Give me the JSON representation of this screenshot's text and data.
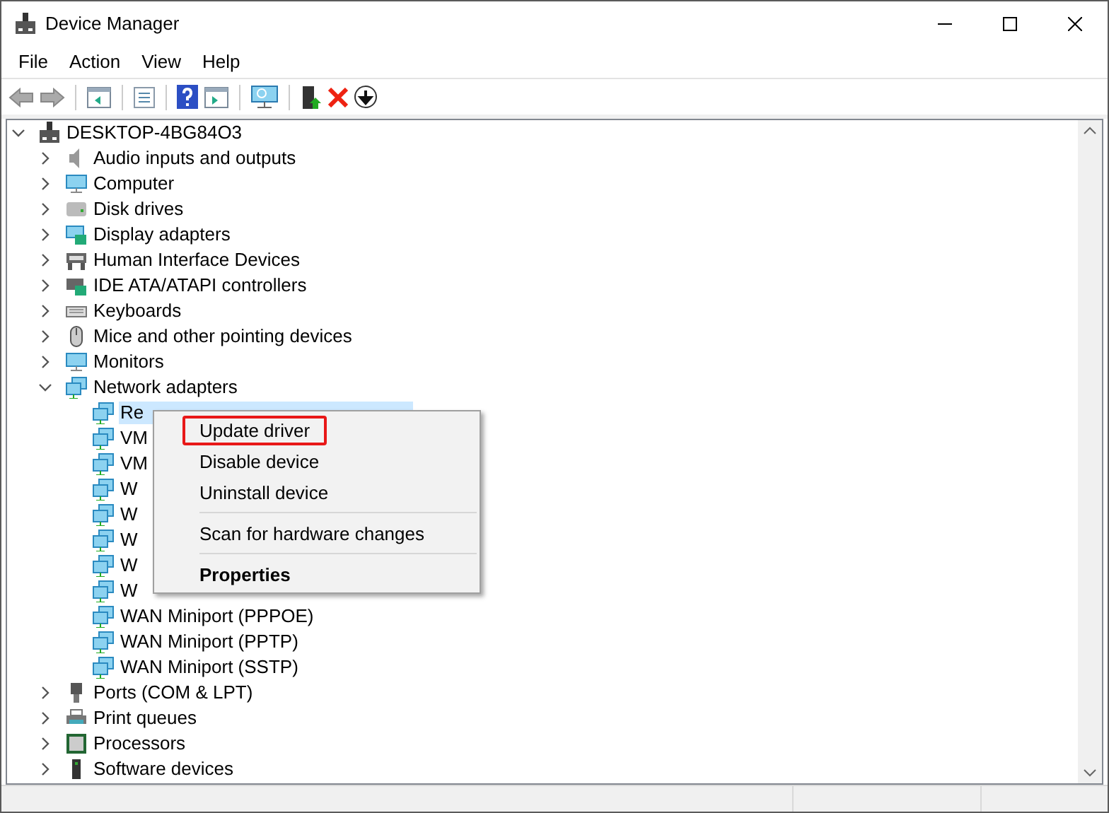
{
  "window": {
    "title": "Device Manager"
  },
  "menu": [
    "File",
    "Action",
    "View",
    "Help"
  ],
  "tree": [
    {
      "label": "DESKTOP-4BG84O3",
      "expanded": true,
      "children": [
        {
          "label": "Audio inputs and outputs",
          "expanded": false
        },
        {
          "label": "Computer",
          "expanded": false
        },
        {
          "label": "Disk drives",
          "expanded": false
        },
        {
          "label": "Display adapters",
          "expanded": false
        },
        {
          "label": "Human Interface Devices",
          "expanded": false
        },
        {
          "label": "IDE ATA/ATAPI controllers",
          "expanded": false
        },
        {
          "label": "Keyboards",
          "expanded": false
        },
        {
          "label": "Mice and other pointing devices",
          "expanded": false
        },
        {
          "label": "Monitors",
          "expanded": false
        },
        {
          "label": "Network adapters",
          "expanded": true,
          "children": [
            {
              "label": "Re",
              "selected": true
            },
            {
              "label": "VM",
              "selected": false
            },
            {
              "label": "VM",
              "selected": false
            },
            {
              "label": "W",
              "selected": false
            },
            {
              "label": "W",
              "selected": false
            },
            {
              "label": "W",
              "selected": false
            },
            {
              "label": "W",
              "selected": false
            },
            {
              "label": "W",
              "selected": false
            },
            {
              "label": "WAN Miniport (PPPOE)",
              "selected": false
            },
            {
              "label": "WAN Miniport (PPTP)",
              "selected": false
            },
            {
              "label": "WAN Miniport (SSTP)",
              "selected": false
            }
          ]
        },
        {
          "label": "Ports (COM & LPT)",
          "expanded": false
        },
        {
          "label": "Print queues",
          "expanded": false
        },
        {
          "label": "Processors",
          "expanded": false
        },
        {
          "label": "Software devices",
          "expanded": false
        }
      ]
    }
  ],
  "context_menu": [
    {
      "kind": "item",
      "label": "Update driver",
      "highlighted": true
    },
    {
      "kind": "item",
      "label": "Disable device",
      "highlighted": false
    },
    {
      "kind": "item",
      "label": "Uninstall device",
      "highlighted": false
    },
    {
      "kind": "separator"
    },
    {
      "kind": "item",
      "label": "Scan for hardware changes",
      "highlighted": false
    },
    {
      "kind": "separator"
    },
    {
      "kind": "default",
      "label": "Properties",
      "highlighted": false
    }
  ]
}
